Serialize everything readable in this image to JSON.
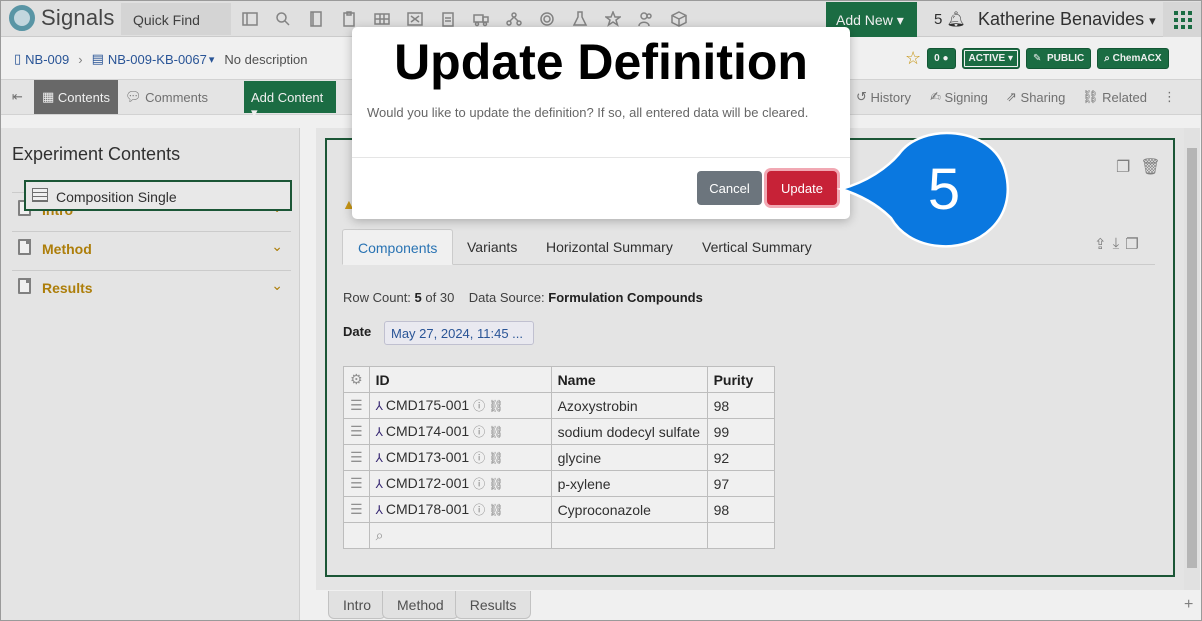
{
  "app": {
    "name": "Signals",
    "quick_find": "Quick Find",
    "add_new": "Add New",
    "notif_count": "5",
    "user": "Katherine Benavides"
  },
  "breadcrumb": {
    "notebook": "NB-009",
    "experiment": "NB-009-KB-0067",
    "description": "No description"
  },
  "badges": {
    "comments": "0",
    "status": "ACTIVE",
    "visibility": "PUBLIC",
    "chemacx": "ChemACX"
  },
  "toolbar": {
    "contents": "Contents",
    "comments": "Comments",
    "add_content": "Add Content",
    "history": "History",
    "signing": "Signing",
    "sharing": "Sharing",
    "related": "Related"
  },
  "left": {
    "title": "Experiment Contents",
    "sections": [
      {
        "label": "Intro"
      },
      {
        "label": "Method"
      },
      {
        "label": "Results"
      }
    ],
    "selected": "Composition Single"
  },
  "main": {
    "tabs": [
      "Components",
      "Variants",
      "Horizontal Summary",
      "Vertical Summary"
    ],
    "row_count_label": "Row Count:",
    "row_count_value": "5",
    "row_count_total": "of 30",
    "data_source_label": "Data Source:",
    "data_source_value": "Formulation Compounds",
    "date_label": "Date",
    "date_value": "May 27, 2024, 11:45 ...",
    "columns": [
      "ID",
      "Name",
      "Purity"
    ],
    "rows": [
      {
        "id": "CMD175-001",
        "name": "Azoxystrobin",
        "purity": "98"
      },
      {
        "id": "CMD174-001",
        "name": "sodium dodecyl sulfate",
        "purity": "99"
      },
      {
        "id": "CMD173-001",
        "name": "glycine",
        "purity": "92"
      },
      {
        "id": "CMD172-001",
        "name": "p-xylene",
        "purity": "97"
      },
      {
        "id": "CMD178-001",
        "name": "Cyproconazole",
        "purity": "98"
      }
    ]
  },
  "bottom_tabs": [
    "Intro",
    "Method",
    "Results"
  ],
  "modal": {
    "title": "Update Definition",
    "message": "Would you like to update the definition? If so, all entered data will be cleared.",
    "cancel": "Cancel",
    "update": "Update"
  },
  "callout": {
    "step": "5",
    "color": "#0a78e0"
  },
  "colors": {
    "brand_green": "#1d7348",
    "danger": "#c72237",
    "link": "#2c5aa0"
  }
}
